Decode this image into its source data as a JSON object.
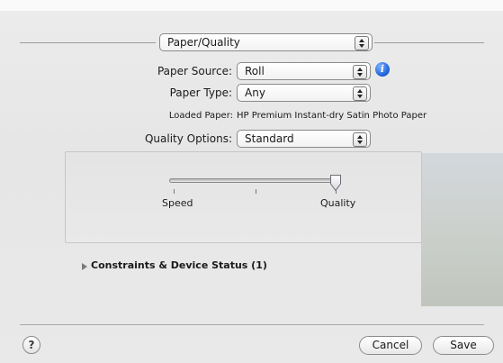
{
  "panel_selector": {
    "value": "Paper/Quality"
  },
  "paper_source": {
    "label": "Paper Source:",
    "value": "Roll"
  },
  "paper_type": {
    "label": "Paper Type:",
    "value": "Any"
  },
  "loaded_paper": {
    "label": "Loaded Paper:",
    "value": "HP Premium Instant-dry Satin Photo Paper"
  },
  "quality_options": {
    "label": "Quality Options:",
    "value": "Standard"
  },
  "speed_quality": {
    "speed_label": "Speed",
    "quality_label": "Quality",
    "level": 1.0
  },
  "constraints": {
    "label": "Constraints & Device Status (1)"
  },
  "footer": {
    "help_label": "?",
    "cancel_label": "Cancel",
    "save_label": "Save"
  },
  "icons": {
    "info": "info-icon",
    "disclosure": "disclosure-triangle-icon",
    "help": "help-icon"
  },
  "colors": {
    "info_blue": "#1b5fd6",
    "background": "#e8e8e8"
  }
}
